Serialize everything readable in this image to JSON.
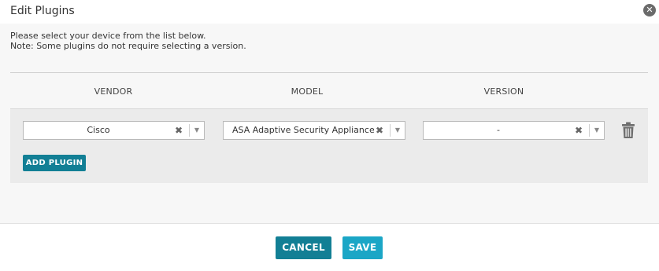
{
  "dialog": {
    "title": "Edit Plugins",
    "close_glyph": "✕",
    "close_icon": "close-circle-icon"
  },
  "instructions": {
    "line1": "Please select your device from the list below.",
    "line2": "Note: Some plugins do not require selecting a version."
  },
  "columns": {
    "vendor": "VENDOR",
    "model": "MODEL",
    "version": "VERSION"
  },
  "row": {
    "vendor_value": "Cisco",
    "model_value": "ASA Adaptive Security Appliance",
    "version_value": "-",
    "clear_glyph": "✖",
    "arrow_glyph": "▼",
    "delete_icon": "trash-icon"
  },
  "actions": {
    "add_plugin": "ADD PLUGIN",
    "cancel": "CANCEL",
    "save": "SAVE"
  },
  "colors": {
    "primary": "#127f95",
    "save": "#1ba6c6",
    "panel": "#ebebeb",
    "body": "#f7f7f7"
  }
}
